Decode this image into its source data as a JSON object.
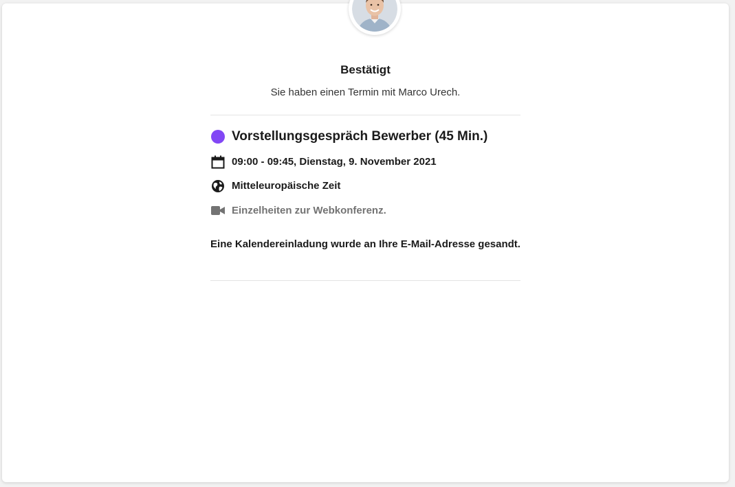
{
  "confirmation": {
    "title": "Bestätigt",
    "subtitle": "Sie haben einen Termin mit Marco Urech."
  },
  "event": {
    "name": "Vorstellungsgespräch Bewerber (45 Min.)",
    "color": "#8247f5",
    "datetime": "09:00 - 09:45, Dienstag, 9. November 2021",
    "timezone": "Mitteleuropäische Zeit",
    "webconference": "Einzelheiten zur Webkonferenz."
  },
  "invite_notice": "Eine Kalendereinladung wurde an Ihre E-Mail-Adresse gesandt.",
  "icons": {
    "event_color": "event-color-dot-icon",
    "calendar": "calendar-icon",
    "timezone": "globe-icon",
    "webconference": "video-camera-icon"
  }
}
